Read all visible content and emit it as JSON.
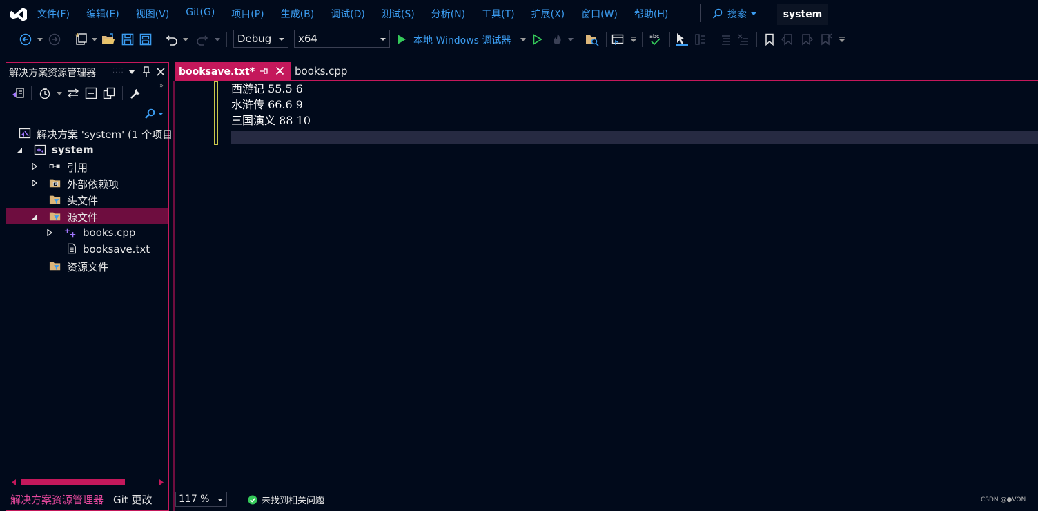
{
  "menubar": {
    "items": [
      "文件(F)",
      "编辑(E)",
      "视图(V)",
      "Git(G)",
      "项目(P)",
      "生成(B)",
      "调试(D)",
      "测试(S)",
      "分析(N)",
      "工具(T)",
      "扩展(X)",
      "窗口(W)",
      "帮助(H)"
    ],
    "search_label": "搜索",
    "solution_name": "system"
  },
  "toolbar": {
    "config": "Debug",
    "platform": "x64",
    "run_label": "本地 Windows 调试器"
  },
  "solution_explorer": {
    "title": "解决方案资源管理器",
    "tree": [
      {
        "label": "解决方案 'system' (1 个项目",
        "icon": "solution-icon"
      },
      {
        "label": "system",
        "icon": "project-icon",
        "expanded": true
      },
      {
        "label": "引用",
        "icon": "references-icon",
        "expanded": false
      },
      {
        "label": "外部依赖项",
        "icon": "external-deps-icon",
        "expanded": false
      },
      {
        "label": "头文件",
        "icon": "filter-folder-icon"
      },
      {
        "label": "源文件",
        "icon": "filter-folder-icon",
        "expanded": true,
        "selected": true
      },
      {
        "label": "books.cpp",
        "icon": "cpp-file-icon",
        "expanded": false
      },
      {
        "label": "booksave.txt",
        "icon": "text-file-icon"
      },
      {
        "label": "资源文件",
        "icon": "filter-folder-icon"
      }
    ],
    "bottom_tabs": [
      "解决方案资源管理器",
      "Git 更改"
    ]
  },
  "editor": {
    "tabs": [
      {
        "label": "booksave.txt*",
        "active": true
      },
      {
        "label": "books.cpp",
        "active": false
      }
    ],
    "lines": [
      "西游记 55.5 6",
      "水浒传 66.6 9",
      "三国演义 88 10",
      ""
    ],
    "zoom": "117 %",
    "issues_status": "未找到相关问题"
  },
  "watermark": "CSDN @●VON",
  "colors": {
    "accent": "#c4185b",
    "selection": "#6e0d3f",
    "menu_text": "#3b9cf0",
    "background": "#010a1b",
    "current_line": "#262a42"
  }
}
